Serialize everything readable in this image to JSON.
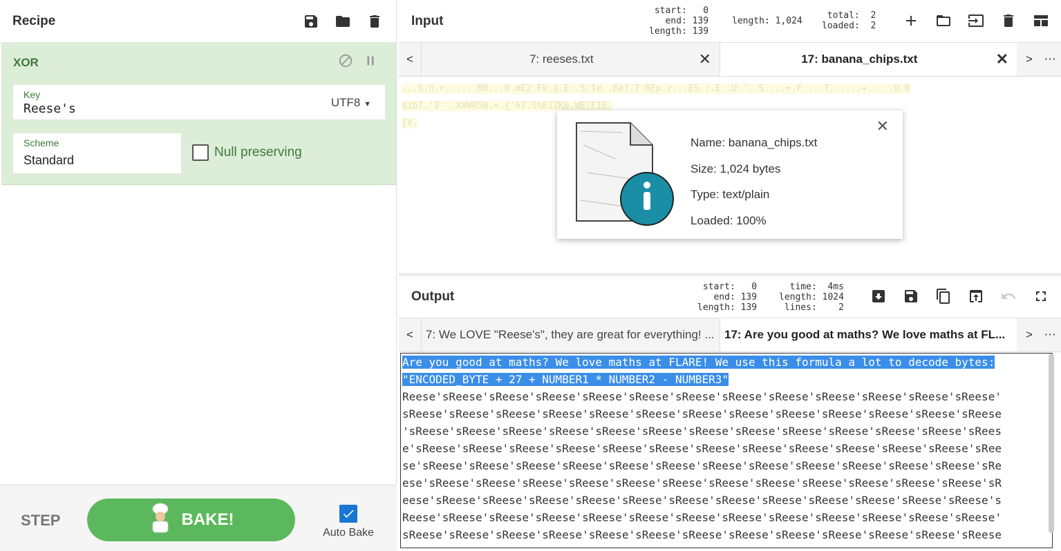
{
  "recipe": {
    "title": "Recipe",
    "operation": {
      "name": "XOR",
      "key_label": "Key",
      "key_value": "Reese's",
      "key_encoding": "UTF8",
      "scheme_label": "Scheme",
      "scheme_value": "Standard",
      "null_preserving_label": "Null preserving",
      "null_preserving_checked": false
    },
    "step_label": "STEP",
    "bake_label": "BAKE!",
    "auto_bake_label": "Auto Bake",
    "auto_bake_checked": true
  },
  "input": {
    "title": "Input",
    "stats_sel": "start:   0\n  end: 139\nlength: 139",
    "stats_length": "length: 1,024",
    "stats_total": "total:  2\nloaded:  2",
    "tabs": [
      {
        "label": "7: reeses.txt",
        "active": false
      },
      {
        "label": "17: banana_chips.txt",
        "active": true
      }
    ],
    "text_lines": [
      "...S.h.r......M8...O.mE2.Fk.$.E..S.Ie..Ea?.7 REp.r...ES.;.E..U.'..S....=.F....7......+... .O.R",
      "$ib7.'2' .X#WRSN.=.{'67.S%E1ZK6.WE?F1E.",
      "[V."
    ],
    "file_info": {
      "name": "Name: banana_chips.txt",
      "size": "Size: 1,024 bytes",
      "type": "Type: text/plain",
      "loaded": "Loaded: 100%"
    }
  },
  "output": {
    "title": "Output",
    "stats_sel": "start:   0\n  end: 139\nlength: 139",
    "stats_time": "time:  4ms\nlength: 1024\nlines:    2",
    "tabs": [
      {
        "label": "7: We LOVE \"Reese's\", they are great for everything! ...",
        "active": false
      },
      {
        "label": "17: Are you good at maths? We love maths at FL...",
        "active": true
      }
    ],
    "selected_lines": [
      "Are you good at maths? We love maths at FLARE! We use this formula a lot to decode bytes: ",
      "\"ENCODED_BYTE + 27 + NUMBER1 * NUMBER2 - NUMBER3\""
    ],
    "lines": [
      "Reese'sReese'sReese'sReese'sReese'sReese'sReese'sReese'sReese'sReese'sReese'sReese'sReese'",
      "sReese'sReese'sReese'sReese'sReese'sReese'sReese'sReese'sReese'sReese'sReese'sReese'sReese",
      "'sReese'sReese'sReese'sReese'sReese'sReese'sReese'sReese'sReese'sReese'sReese'sReese'sRees",
      "e'sReese'sReese'sReese'sReese'sReese'sReese'sReese'sReese'sReese'sReese'sReese'sReese'sRee",
      "se'sReese'sReese'sReese'sReese'sReese'sReese'sReese'sReese'sReese'sReese'sReese'sReese'sRe",
      "ese'sReese'sReese'sReese'sReese'sReese'sReese'sReese'sReese'sReese'sReese'sReese'sReese'sR",
      "eese'sReese'sReese'sReese'sReese'sReese'sReese'sReese'sReese'sReese'sReese'sReese'sReese's",
      "Reese'sReese'sReese'sReese'sReese'sReese'sReese'sReese'sReese'sReese'sReese'sReese'sReese'",
      "sReese'sReese'sReese'sReese'sReese'sReese'sReese'sReese'sReese'sReese'sReese'sReese'sReese"
    ]
  },
  "icons": {
    "save": "save-icon",
    "open": "folder-icon",
    "delete": "trash-icon",
    "add": "plus-icon",
    "layout": "layout-icon",
    "disable": "disable-icon",
    "pause": "pause-icon"
  },
  "colors": {
    "op_bg": "#dcedd8",
    "op_text": "#3e7a3a",
    "bake_green": "#5cb85c",
    "selection_blue": "#3b8ee8",
    "checkbox_blue": "#1976d2"
  }
}
